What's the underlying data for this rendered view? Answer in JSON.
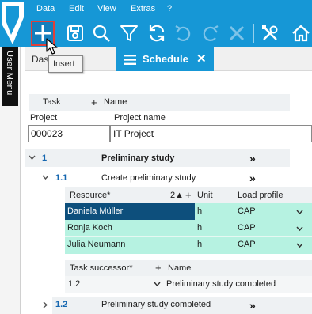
{
  "menu": {
    "items": [
      "Data",
      "Edit",
      "View",
      "Extras",
      "?"
    ]
  },
  "toolbar": {
    "buttons": [
      "insert-icon",
      "save-icon",
      "search-icon",
      "filter-icon",
      "refresh-icon",
      "undo-icon",
      "redo-icon",
      "delete-icon",
      "tools-icon",
      "home-icon"
    ],
    "tooltip": "Insert"
  },
  "sidebar": {
    "user_menu_label": "User Menu"
  },
  "tabs": {
    "inactive_label": "Dashboard",
    "active_label": "Schedule",
    "close_glyph": "✕"
  },
  "header": {
    "task_label": "Task",
    "add_glyph": "+",
    "name_label": "Name",
    "project_label": "Project",
    "project_name_label": "Project name",
    "project_value": "000023",
    "project_name_value": "IT Project"
  },
  "tasks": [
    {
      "number": "1",
      "name": "Preliminary study",
      "nav": "»"
    },
    {
      "number": "1.1",
      "name": "Create preliminary study",
      "nav": "»"
    },
    {
      "number": "1.2",
      "name": "Preliminary study completed",
      "nav": "»"
    }
  ],
  "resources": {
    "resource_header": "Resource*",
    "sort_indicator": "2▲",
    "add_glyph": "+",
    "unit_header": "Unit",
    "load_profile_header": "Load profile",
    "rows": [
      {
        "name": "Daniela Müller",
        "unit": "h",
        "profile": "CAP"
      },
      {
        "name": "Ronja Koch",
        "unit": "h",
        "profile": "CAP"
      },
      {
        "name": "Julia Neumann",
        "unit": "h",
        "profile": "CAP"
      }
    ]
  },
  "successors": {
    "header": "Task successor*",
    "add_glyph": "+",
    "name_header": "Name",
    "row": {
      "task": "1.2",
      "name": "Preliminary study completed"
    }
  },
  "colors": {
    "brand": "#1697d6",
    "selected_row": "#0d4f7c",
    "resource_row": "#b6f2e1",
    "link_number": "#1567b0"
  }
}
